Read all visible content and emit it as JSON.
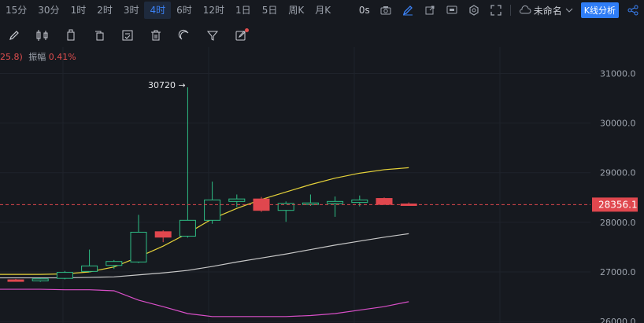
{
  "timeframes": [
    {
      "label": "15分",
      "active": false
    },
    {
      "label": "30分",
      "active": false
    },
    {
      "label": "1时",
      "active": false
    },
    {
      "label": "2时",
      "active": false
    },
    {
      "label": "3时",
      "active": false
    },
    {
      "label": "4时",
      "active": true
    },
    {
      "label": "6时",
      "active": false
    },
    {
      "label": "12时",
      "active": false
    },
    {
      "label": "1日",
      "active": false
    },
    {
      "label": "5日",
      "active": false
    },
    {
      "label": "周K",
      "active": false
    },
    {
      "label": "月K",
      "active": false
    }
  ],
  "right_tools": {
    "countdown": "0s",
    "layout_name": "未命名",
    "k_analysis": "K线分析"
  },
  "drawing_tools": [
    "pencil-icon",
    "candlestick-icon",
    "bookmark-icon",
    "copy-icon",
    "checklist-icon",
    "trash-icon",
    "magnet-icon",
    "filter-icon",
    "edit-icon"
  ],
  "info": {
    "prefix": "25.8)",
    "amplitude_label": "振幅",
    "amplitude_value": "0.41%"
  },
  "annotation": {
    "high_label": "30720 →"
  },
  "colors": {
    "background": "#16191f",
    "up": "#2ebd85",
    "down": "#e0474e",
    "ma_yellow": "#e5d23a",
    "ma_white": "#c8c8c8",
    "ma_magenta": "#d94fc8",
    "accent": "#3b82f6"
  },
  "chart_data": {
    "type": "candlestick",
    "current_price": "28356.1",
    "y_ticks": [
      "31000.0",
      "30000.0",
      "29000.0",
      "28000.0",
      "27000.0",
      "26000.0"
    ],
    "ylim": [
      25970,
      31530
    ],
    "candles": [
      {
        "o": 26840,
        "h": 26860,
        "l": 26820,
        "c": 26815
      },
      {
        "o": 26820,
        "h": 26870,
        "l": 26800,
        "c": 26860
      },
      {
        "o": 26870,
        "h": 27020,
        "l": 26850,
        "c": 26990
      },
      {
        "o": 27010,
        "h": 27450,
        "l": 26990,
        "c": 27120
      },
      {
        "o": 27130,
        "h": 27240,
        "l": 27060,
        "c": 27210
      },
      {
        "o": 27200,
        "h": 28150,
        "l": 27180,
        "c": 27800
      },
      {
        "o": 27810,
        "h": 27840,
        "l": 27600,
        "c": 27700
      },
      {
        "o": 27720,
        "h": 30720,
        "l": 27690,
        "c": 28040
      },
      {
        "o": 28040,
        "h": 28820,
        "l": 27970,
        "c": 28450
      },
      {
        "o": 28420,
        "h": 28560,
        "l": 28310,
        "c": 28470
      },
      {
        "o": 28470,
        "h": 28510,
        "l": 28210,
        "c": 28240
      },
      {
        "o": 28240,
        "h": 28420,
        "l": 28010,
        "c": 28380
      },
      {
        "o": 28370,
        "h": 28560,
        "l": 28330,
        "c": 28390
      },
      {
        "o": 28380,
        "h": 28520,
        "l": 28110,
        "c": 28420
      },
      {
        "o": 28400,
        "h": 28540,
        "l": 28320,
        "c": 28450
      },
      {
        "o": 28480,
        "h": 28500,
        "l": 28350,
        "c": 28360
      },
      {
        "o": 28370,
        "h": 28400,
        "l": 28330,
        "c": 28356
      }
    ],
    "ma_yellow": [
      26950,
      26950,
      26960,
      27000,
      27100,
      27300,
      27520,
      27780,
      28070,
      28280,
      28460,
      28610,
      28760,
      28890,
      28990,
      29060,
      29100
    ],
    "ma_white": [
      26880,
      26880,
      26880,
      26890,
      26900,
      26940,
      26980,
      27030,
      27110,
      27200,
      27280,
      27360,
      27450,
      27540,
      27620,
      27700,
      27770
    ],
    "ma_magenta": [
      26650,
      26650,
      26640,
      26640,
      26620,
      26430,
      26300,
      26160,
      26100,
      26100,
      26100,
      26100,
      26120,
      26160,
      26230,
      26300,
      26400
    ]
  }
}
